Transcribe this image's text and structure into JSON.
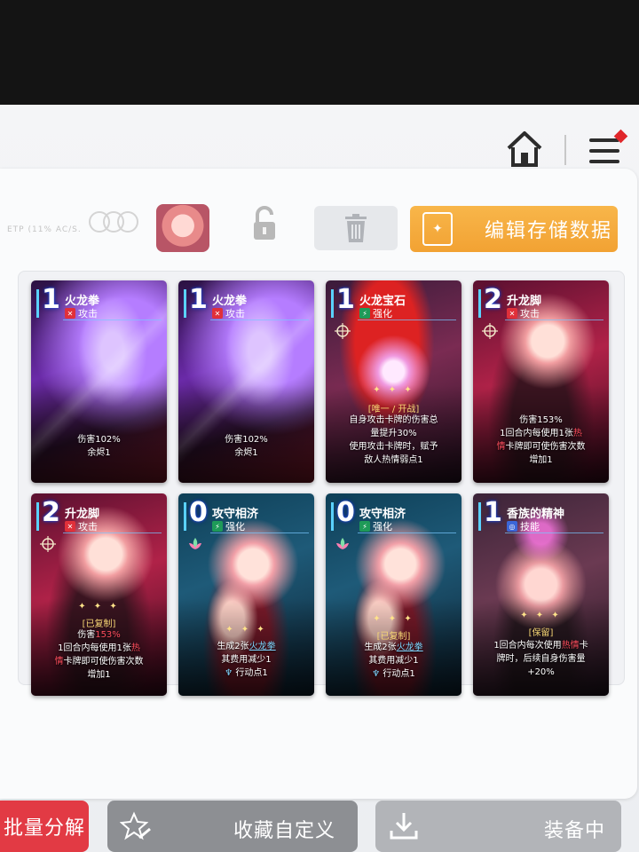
{
  "toolbar": {
    "stats_faint": "ETP (11% AC/S.",
    "edit_save_label": "编辑存储数据"
  },
  "cards": [
    {
      "cost": "1",
      "name": "火龙拳",
      "type": "攻击",
      "type_icon": "crossed-swords-icon",
      "type_color": "#e0303a",
      "desc": [
        "伤害102%",
        "余烬1"
      ]
    },
    {
      "cost": "1",
      "name": "火龙拳",
      "type": "攻击",
      "type_icon": "crossed-swords-icon",
      "type_color": "#e0303a",
      "desc": [
        "伤害102%",
        "余烬1"
      ]
    },
    {
      "cost": "1",
      "name": "火龙宝石",
      "type": "强化",
      "type_icon": "lightning-icon",
      "type_color": "#1e9a58",
      "badge": "[唯一 / 开战]",
      "desc": [
        "自身攻击卡牌的伤害总",
        "量提升30%",
        "使用攻击卡牌时，赋予",
        "敌人热情弱点1"
      ]
    },
    {
      "cost": "2",
      "name": "升龙脚",
      "type": "攻击",
      "type_icon": "crossed-swords-icon",
      "type_color": "#e0303a",
      "desc_a": "伤害153%",
      "desc_b1": "1回合内每使用1张",
      "desc_b2": "热",
      "desc_c1": "情",
      "desc_c2": "卡牌即可使伤害次数",
      "desc_d": "增加1"
    },
    {
      "cost": "2",
      "name": "升龙脚",
      "type": "攻击",
      "type_icon": "crossed-swords-icon",
      "type_color": "#e0303a",
      "badge": "[已复制]",
      "desc_a1": "伤害",
      "desc_a2": "153%",
      "desc_b1": "1回合内每使用1张",
      "desc_b2": "热",
      "desc_c1": "情",
      "desc_c2": "卡牌即可使伤害次数",
      "desc_d": "增加1"
    },
    {
      "cost": "0",
      "name": "攻守相济",
      "type": "强化",
      "type_icon": "lightning-icon",
      "type_color": "#1e9a58",
      "desc_a1": "生成2张",
      "desc_a2": "火龙拳",
      "desc_b": "其费用减少1",
      "desc_c": "行动点1"
    },
    {
      "cost": "0",
      "name": "攻守相济",
      "type": "强化",
      "type_icon": "lightning-icon",
      "type_color": "#1e9a58",
      "badge": "[已复制]",
      "desc_a1": "生成2张",
      "desc_a2": "火龙拳",
      "desc_b": "其费用减少1",
      "desc_c": "行动点1"
    },
    {
      "cost": "1",
      "name": "香族的精神",
      "type": "技能",
      "type_icon": "skill-icon",
      "type_color": "#3b66d8",
      "badge": "[保留]",
      "desc_a1": "1回合内每次使用",
      "desc_a2": "热情",
      "desc_a3": "卡",
      "desc_b": "牌时，后续自身伤害量",
      "desc_c": "+20%"
    }
  ],
  "bottom": {
    "batch_label": "批量分解",
    "favorite_label": "收藏自定义",
    "equip_label": "装备中"
  }
}
